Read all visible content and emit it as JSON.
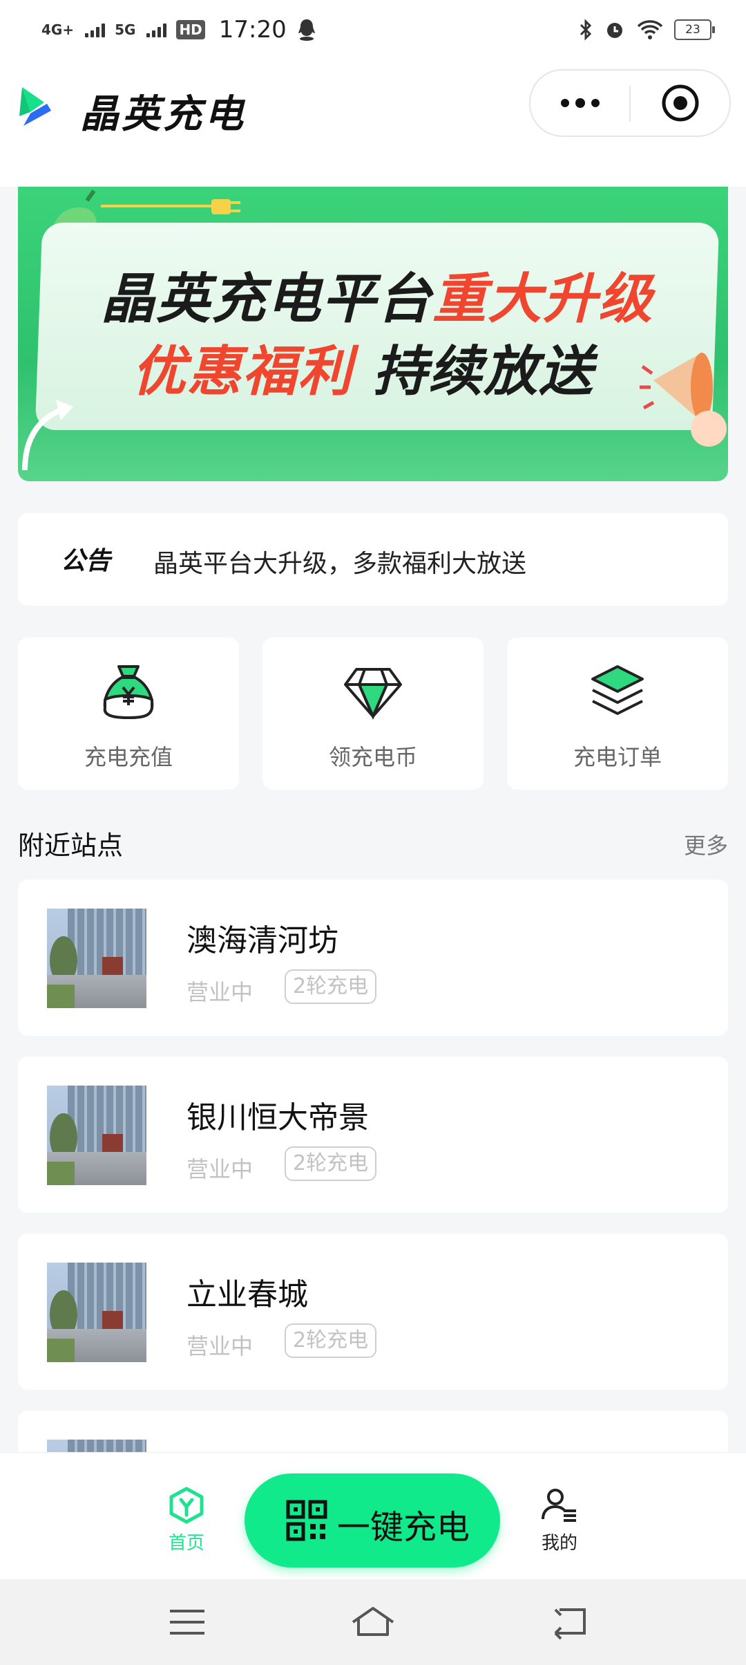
{
  "status_bar": {
    "network_1": "4G+",
    "network_2": "5G",
    "hd_badge": "HD",
    "time": "17:20",
    "battery": "23"
  },
  "header": {
    "app_title": "晶英充电"
  },
  "banner": {
    "line1_dark": "晶英充电平台",
    "line1_red": "重大升级",
    "line2_red": "优惠福利",
    "line2_dark": "持续放送"
  },
  "notice": {
    "tag": "公告",
    "text": "晶英平台大升级，多款福利大放送"
  },
  "quick_actions": [
    {
      "label": "充电充值",
      "icon": "money-bag-icon"
    },
    {
      "label": "领充电币",
      "icon": "diamond-icon"
    },
    {
      "label": "充电订单",
      "icon": "layers-icon"
    }
  ],
  "nearby": {
    "title": "附近站点",
    "more": "更多",
    "stations": [
      {
        "name": "澳海清河坊",
        "status": "营业中",
        "tag": "2轮充电"
      },
      {
        "name": "银川恒大帝景",
        "status": "营业中",
        "tag": "2轮充电"
      },
      {
        "name": "立业春城",
        "status": "营业中",
        "tag": "2轮充电"
      }
    ]
  },
  "tabbar": {
    "home": "首页",
    "scan_charge": "一键充电",
    "mine": "我的"
  },
  "colors": {
    "accent": "#10ea8a",
    "home_active": "#1fe28f",
    "banner_red": "#f0452f",
    "banner_green": "#3bd37a"
  }
}
